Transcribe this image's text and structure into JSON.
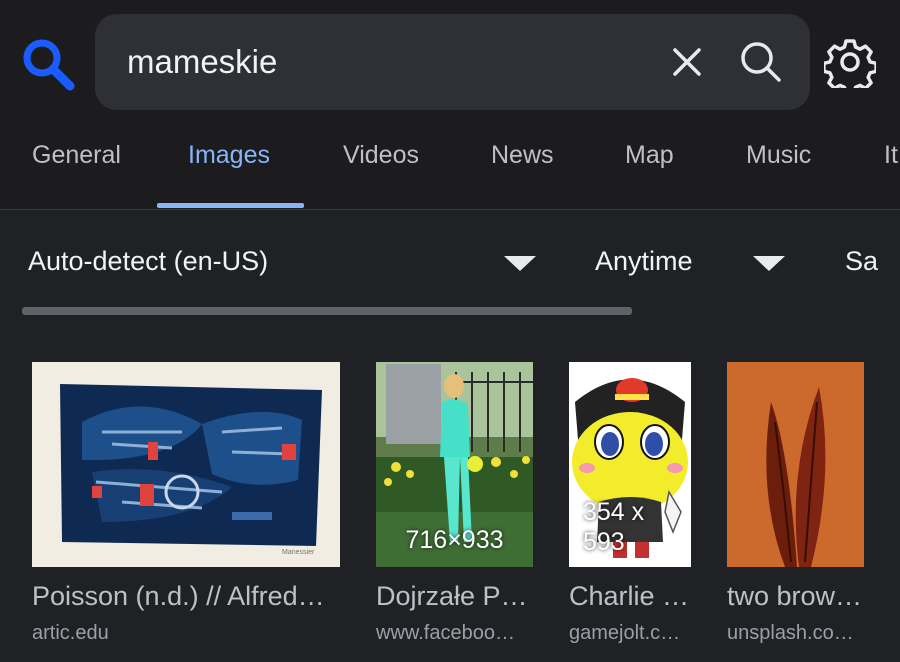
{
  "search": {
    "query": "mameskie"
  },
  "icons": {
    "logo": "magnifier-logo-icon",
    "clear": "close-icon",
    "search": "search-icon",
    "settings": "gear-icon"
  },
  "colors": {
    "accent": "#8ab4f8",
    "logo": "#1a5cff",
    "background": "#202124",
    "header": "#1c1c1f"
  },
  "tabs": [
    {
      "label": "General",
      "active": false
    },
    {
      "label": "Images",
      "active": true
    },
    {
      "label": "Videos",
      "active": false
    },
    {
      "label": "News",
      "active": false
    },
    {
      "label": "Map",
      "active": false
    },
    {
      "label": "Music",
      "active": false
    },
    {
      "label": "It",
      "active": false
    }
  ],
  "filters": {
    "language": "Auto-detect (en-US)",
    "time": "Anytime",
    "safe": "Sa"
  },
  "results": [
    {
      "title": "Poisson (n.d.) // Alfred…",
      "source": "artic.edu",
      "dimensions": ""
    },
    {
      "title": "Dojrzałe P…",
      "source": "www.faceboo…",
      "dimensions": "716×933"
    },
    {
      "title": "Charlie …",
      "source": "gamejolt.c…",
      "dimensions": "354 x 593"
    },
    {
      "title": "two brow…",
      "source": "unsplash.co…",
      "dimensions": ""
    }
  ]
}
